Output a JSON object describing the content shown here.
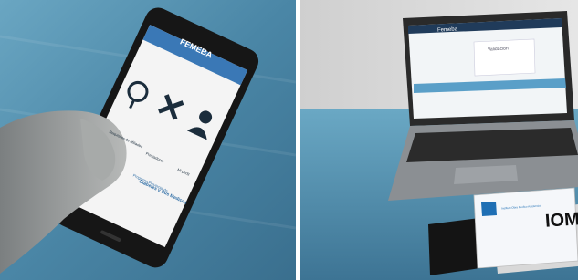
{
  "phone": {
    "app_brand": "FEMEBA",
    "menu_items": [
      {
        "label": "Requisitos de afiliados",
        "icon": "stethoscope-icon"
      },
      {
        "label": "Prestadores",
        "icon": "tools-icon"
      },
      {
        "label": "Mi perfil",
        "icon": "user-icon"
      }
    ],
    "footer_line1": "Programa Provincial de",
    "footer_line2": "Diabetes y Sus Medicos"
  },
  "laptop": {
    "screen_header": "Femeba",
    "screen_panel_title": "Validacion"
  },
  "card": {
    "brand": "IOMA",
    "small_text": "Instituto Obra Medico Asistencial"
  },
  "colors": {
    "table_blue": "#4a86a6",
    "app_header_blue": "#3a78b6",
    "card_blue": "#1f6fb4"
  }
}
